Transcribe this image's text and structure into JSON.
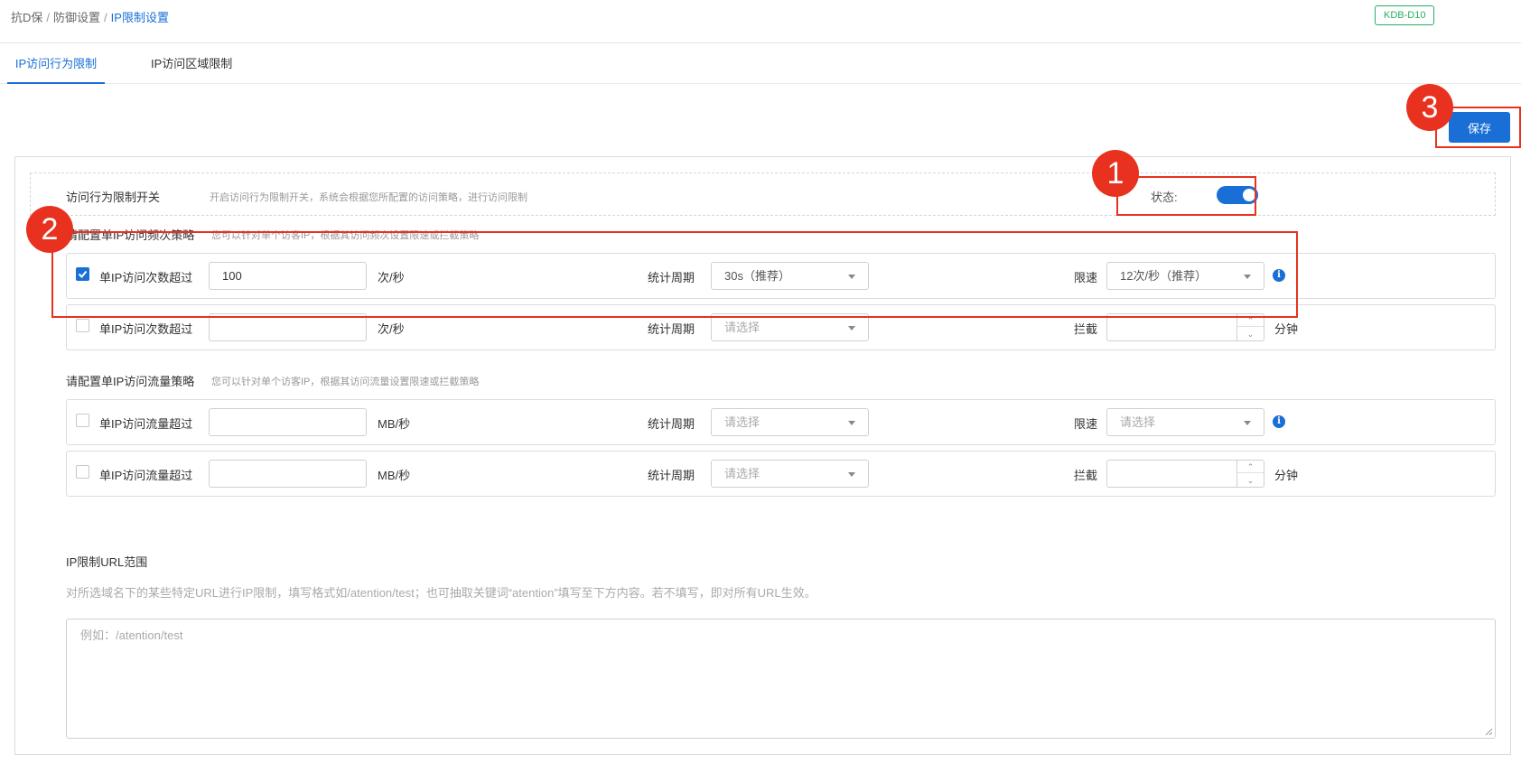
{
  "breadcrumb": {
    "items": [
      "抗D保",
      "防御设置"
    ],
    "separator": "/",
    "current": "IP限制设置"
  },
  "header": {
    "tag": "KDB-D10"
  },
  "tabs": [
    {
      "label": "IP访问行为限制",
      "active": true
    },
    {
      "label": "IP访问区域限制",
      "active": false
    }
  ],
  "toolbar": {
    "save_label": "保存"
  },
  "switch_section": {
    "title": "访问行为限制开关",
    "desc": "开启访问行为限制开关，系统会根据您所配置的访问策略，进行访问限制",
    "status_label": "状态:",
    "enabled": true
  },
  "freq_section": {
    "title": "请配置单IP访问频次策略",
    "desc": "您可以针对单个访客IP，根据其访问频次设置限速或拦截策略",
    "rules": [
      {
        "checked": true,
        "label": "单IP访问次数超过",
        "value": "100",
        "unit": "次/秒",
        "period_label": "统计周期",
        "period_value": "30s（推荐）",
        "period_placeholder": "",
        "action_label": "限速",
        "action_value": "12次/秒（推荐）",
        "action_placeholder": "",
        "action_kind": "select"
      },
      {
        "checked": false,
        "label": "单IP访问次数超过",
        "value": "",
        "unit": "次/秒",
        "period_label": "统计周期",
        "period_value": "",
        "period_placeholder": "请选择",
        "action_label": "拦截",
        "action_kind": "number",
        "action_unit": "分钟"
      }
    ]
  },
  "flow_section": {
    "title": "请配置单IP访问流量策略",
    "desc": "您可以针对单个访客IP，根据其访问流量设置限速或拦截策略",
    "rules": [
      {
        "checked": false,
        "label": "单IP访问流量超过",
        "value": "",
        "unit": "MB/秒",
        "period_label": "统计周期",
        "period_value": "",
        "period_placeholder": "请选择",
        "action_label": "限速",
        "action_value": "",
        "action_placeholder": "请选择",
        "action_kind": "select"
      },
      {
        "checked": false,
        "label": "单IP访问流量超过",
        "value": "",
        "unit": "MB/秒",
        "period_label": "统计周期",
        "period_value": "",
        "period_placeholder": "请选择",
        "action_label": "拦截",
        "action_kind": "number",
        "action_unit": "分钟"
      }
    ]
  },
  "url_section": {
    "title": "IP限制URL范围",
    "desc": "对所选域名下的某些特定URL进行IP限制，填写格式如/atention/test；也可抽取关键词“atention”填写至下方内容。若不填写，即对所有URL生效。",
    "placeholder": "例如：/atention/test"
  },
  "annotations": [
    {
      "number": "1",
      "target": "status-toggle"
    },
    {
      "number": "2",
      "target": "freq-strategy-first-rule"
    },
    {
      "number": "3",
      "target": "save-button"
    }
  ],
  "colors": {
    "accent": "#1a6fd6",
    "tag_green": "#27ae60",
    "annotation_red": "#e8321f"
  }
}
